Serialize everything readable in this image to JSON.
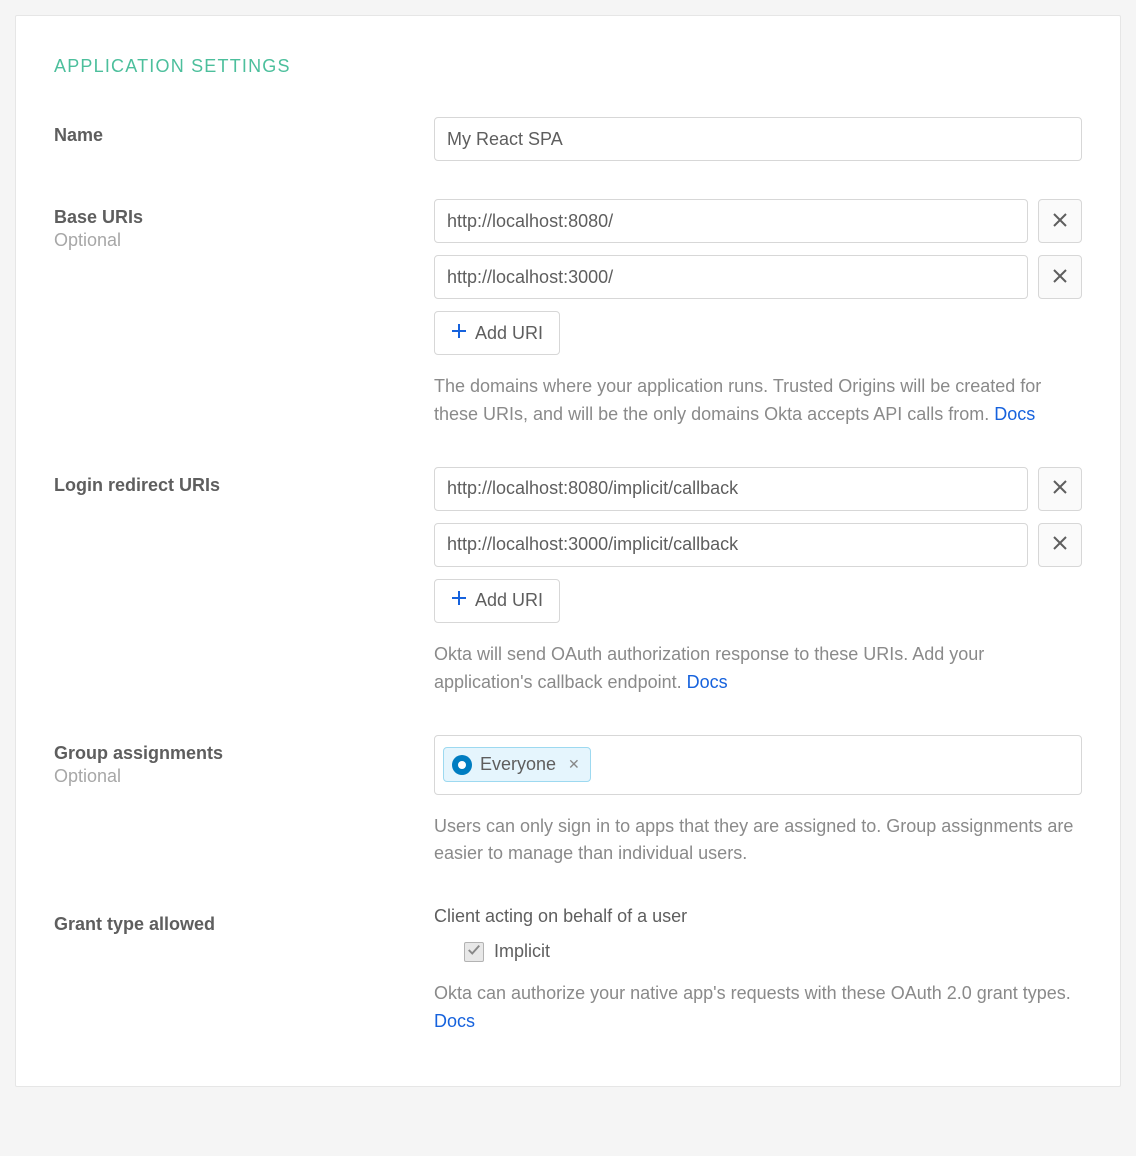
{
  "section_title": "APPLICATION SETTINGS",
  "name_field": {
    "label": "Name",
    "value": "My React SPA"
  },
  "base_uris": {
    "label": "Base URIs",
    "sublabel": "Optional",
    "uris": [
      "http://localhost:8080/",
      "http://localhost:3000/"
    ],
    "add_label": "Add URI",
    "helper_text": "The domains where your application runs. Trusted Origins will be created for these URIs, and will be the only domains Okta accepts API calls from. ",
    "docs_label": "Docs"
  },
  "login_redirect_uris": {
    "label": "Login redirect URIs",
    "uris": [
      "http://localhost:8080/implicit/callback",
      "http://localhost:3000/implicit/callback"
    ],
    "add_label": "Add URI",
    "helper_text": "Okta will send OAuth authorization response to these URIs. Add your application's callback endpoint. ",
    "docs_label": "Docs"
  },
  "group_assignments": {
    "label": "Group assignments",
    "sublabel": "Optional",
    "chips": [
      {
        "name": "Everyone"
      }
    ],
    "helper_text": "Users can only sign in to apps that they are assigned to. Group assignments are easier to manage than individual users."
  },
  "grant_type": {
    "label": "Grant type allowed",
    "heading": "Client acting on behalf of a user",
    "options": [
      {
        "name": "Implicit",
        "checked": true
      }
    ],
    "helper_text": "Okta can authorize your native app's requests with these OAuth 2.0 grant types. ",
    "docs_label": "Docs"
  }
}
